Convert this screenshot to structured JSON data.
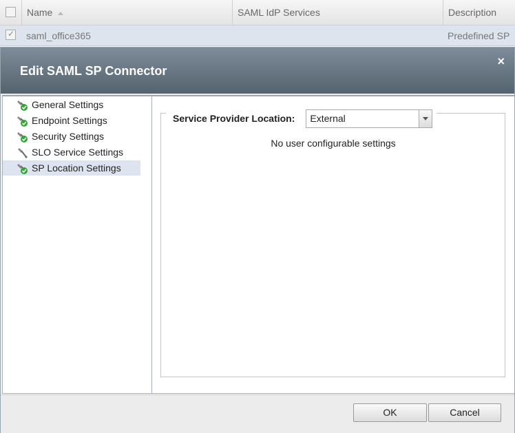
{
  "table": {
    "columns": [
      "Name",
      "SAML IdP Services",
      "Description"
    ],
    "row": {
      "name": "saml_office365",
      "saml_idp_services": "",
      "description": "Predefined SP"
    }
  },
  "dialog": {
    "title": "Edit SAML SP Connector",
    "close_label": "×",
    "nav_items": [
      {
        "label": "General Settings",
        "icon": "checkmark-wrench-icon"
      },
      {
        "label": "Endpoint Settings",
        "icon": "checkmark-wrench-icon"
      },
      {
        "label": "Security Settings",
        "icon": "checkmark-wrench-icon"
      },
      {
        "label": "SLO Service Settings",
        "icon": "wrench-icon"
      },
      {
        "label": "SP Location Settings",
        "icon": "checkmark-wrench-icon",
        "selected": true
      }
    ],
    "content": {
      "field_label": "Service Provider Location:",
      "field_value": "External",
      "info_text": "No user configurable settings"
    },
    "buttons": {
      "ok": "OK",
      "cancel": "Cancel"
    }
  },
  "colors": {
    "header_gradient_top": "#7e8b98",
    "header_gradient_bottom": "#55636f",
    "selected_row": "#dde4f0",
    "check_green": "#2fa82f"
  }
}
